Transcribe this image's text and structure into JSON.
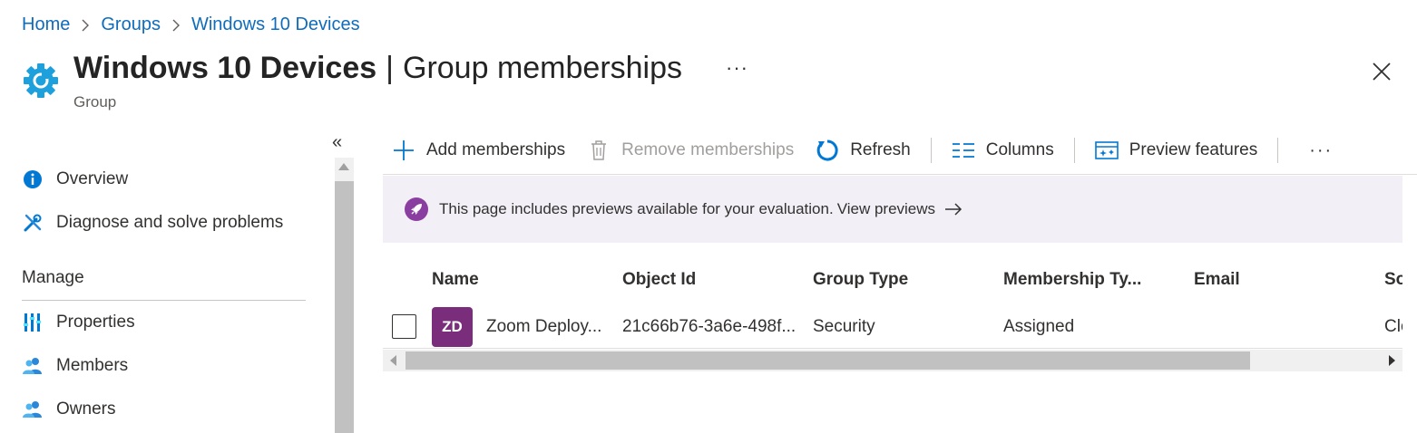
{
  "breadcrumb": [
    {
      "label": "Home"
    },
    {
      "label": "Groups"
    },
    {
      "label": "Windows 10 Devices"
    }
  ],
  "header": {
    "title": "Windows 10 Devices",
    "separator": "|",
    "subtitle_page": "Group memberships",
    "more": "···",
    "type_label": "Group"
  },
  "sidebar": {
    "collapse": "«",
    "items_top": [
      {
        "label": "Overview",
        "icon": "info-icon"
      },
      {
        "label": "Diagnose and solve problems",
        "icon": "wrench-icon"
      }
    ],
    "section": "Manage",
    "items_manage": [
      {
        "label": "Properties",
        "icon": "properties-icon"
      },
      {
        "label": "Members",
        "icon": "members-icon"
      },
      {
        "label": "Owners",
        "icon": "owners-icon"
      }
    ]
  },
  "toolbar": {
    "add": "Add memberships",
    "remove": "Remove memberships",
    "refresh": "Refresh",
    "columns": "Columns",
    "preview": "Preview features",
    "more": "···"
  },
  "banner": {
    "text": "This page includes previews available for your evaluation.",
    "link": "View previews"
  },
  "table": {
    "columns": [
      "Name",
      "Object Id",
      "Group Type",
      "Membership Ty...",
      "Email",
      "So"
    ],
    "rows": [
      {
        "initials": "ZD",
        "name": "Zoom Deploy...",
        "object_id": "21c66b76-3a6e-498f...",
        "group_type": "Security",
        "membership_type": "Assigned",
        "email": "",
        "source": "Clo"
      }
    ]
  },
  "colors": {
    "link": "#0f6cbd",
    "accent_icon": "#0078d4",
    "avatar_bg": "#7a2d7b",
    "banner_bg": "#f3eff6"
  }
}
